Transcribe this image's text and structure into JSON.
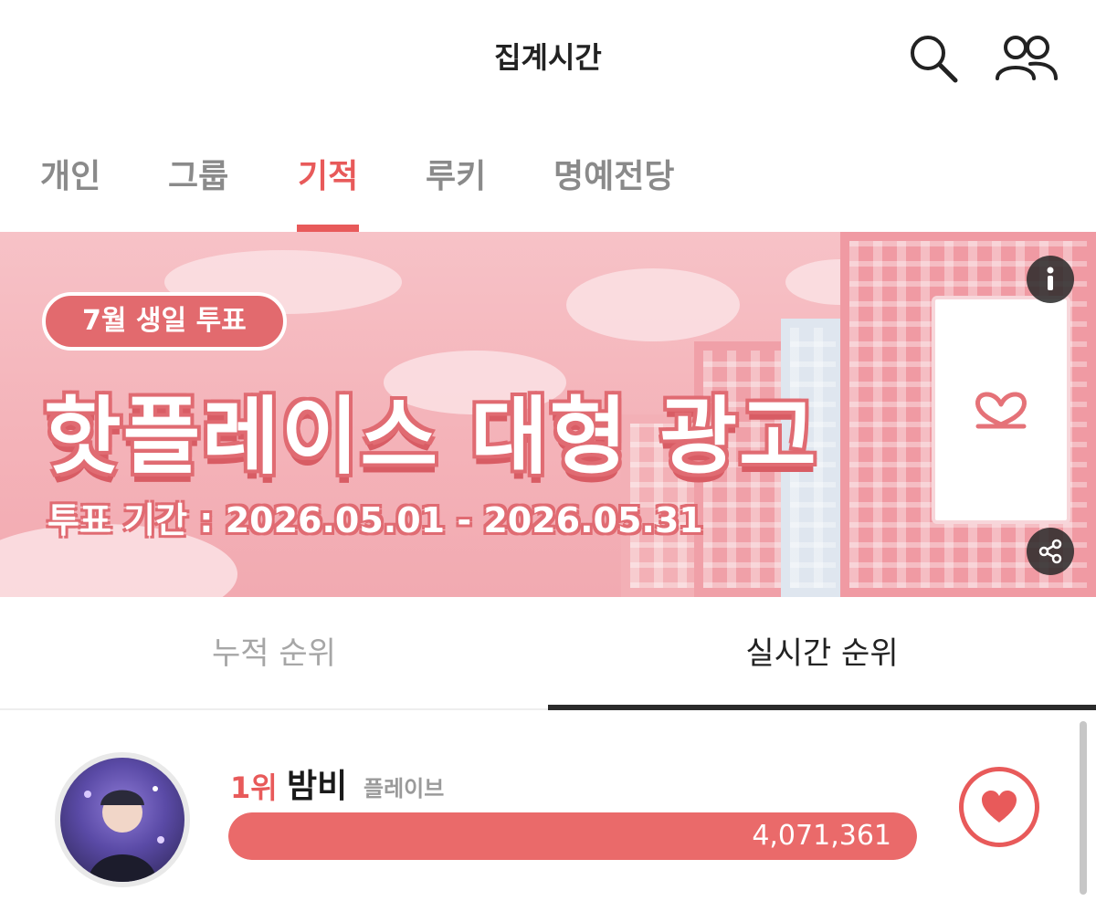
{
  "header": {
    "title": "집계시간",
    "icons": [
      "search-icon",
      "users-icon"
    ]
  },
  "category_tabs": [
    {
      "label": "개인",
      "active": false
    },
    {
      "label": "그룹",
      "active": false
    },
    {
      "label": "기적",
      "active": true
    },
    {
      "label": "루키",
      "active": false
    },
    {
      "label": "명예전당",
      "active": false
    }
  ],
  "banner": {
    "badge": "7월 생일 투표",
    "headline": "핫플레이스 대형 광고",
    "period": "투표 기간 : 2026.05.01 - 2026.05.31",
    "icons": [
      "info-icon",
      "share-icon",
      "heart-logo-icon"
    ]
  },
  "ranking_tabs": [
    {
      "label": "누적 순위",
      "active": false
    },
    {
      "label": "실시간 순위",
      "active": true
    }
  ],
  "rankings": [
    {
      "rank": "1위",
      "name": "밤비",
      "group": "플레이브",
      "votes": "4,071,361",
      "bar_fill_fraction": 1.0
    }
  ],
  "colors": {
    "accent": "#e85a5a",
    "bar_fill": "#ea6a6a",
    "banner_bg": "#f4b3b9",
    "text_muted": "#8a8a8a"
  }
}
